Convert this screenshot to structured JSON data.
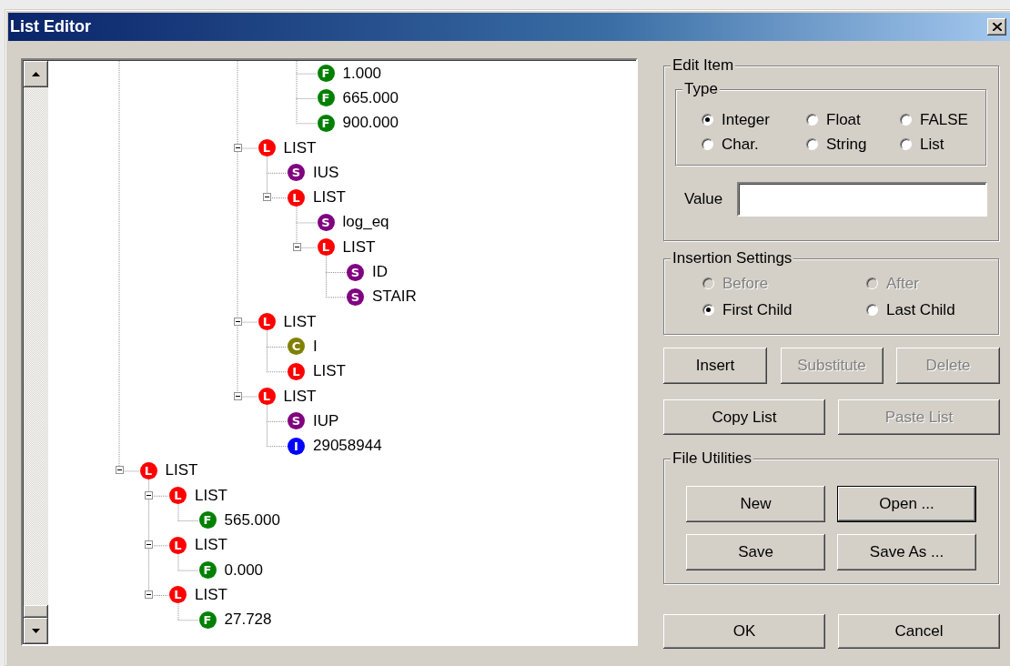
{
  "window": {
    "title": "List Editor"
  },
  "tree": {
    "items": [
      {
        "children": [
          {
            "children": [
              {
                "children": [
                  {
                    "children": [
                      {
                        "children": [
                          {
                            "children": [
                              {
                                "label": "1.000",
                                "badge": "F",
                                "kind": "float"
                              },
                              {
                                "label": "665.000",
                                "badge": "F",
                                "kind": "float"
                              },
                              {
                                "label": "900.000",
                                "badge": "F",
                                "kind": "float"
                              }
                            ]
                          }
                        ]
                      },
                      {
                        "label": "LIST",
                        "badge": "L",
                        "kind": "list",
                        "expanded": true,
                        "children": [
                          {
                            "label": "IUS",
                            "badge": "S",
                            "kind": "string"
                          },
                          {
                            "label": "LIST",
                            "badge": "L",
                            "kind": "list",
                            "expanded": true,
                            "children": [
                              {
                                "label": "log_eq",
                                "badge": "S",
                                "kind": "string"
                              },
                              {
                                "label": "LIST",
                                "badge": "L",
                                "kind": "list",
                                "expanded": true,
                                "children": [
                                  {
                                    "label": "ID",
                                    "badge": "S",
                                    "kind": "string"
                                  },
                                  {
                                    "label": "STAIR",
                                    "badge": "S",
                                    "kind": "string"
                                  }
                                ]
                              }
                            ]
                          }
                        ]
                      },
                      {
                        "label": "LIST",
                        "badge": "L",
                        "kind": "list",
                        "expanded": true,
                        "children": [
                          {
                            "label": "I",
                            "badge": "C",
                            "kind": "char"
                          },
                          {
                            "label": "LIST",
                            "badge": "L",
                            "kind": "list"
                          }
                        ]
                      },
                      {
                        "label": "LIST",
                        "badge": "L",
                        "kind": "list",
                        "expanded": true,
                        "children": [
                          {
                            "label": "IUP",
                            "badge": "S",
                            "kind": "string"
                          },
                          {
                            "label": "29058944",
                            "badge": "I",
                            "kind": "integer"
                          }
                        ]
                      }
                    ]
                  }
                ]
              }
            ]
          }
        ]
      },
      {
        "label": "LIST",
        "badge": "L",
        "kind": "list",
        "expanded": true,
        "children": [
          {
            "label": "LIST",
            "badge": "L",
            "kind": "list",
            "expanded": true,
            "children": [
              {
                "label": "565.000",
                "badge": "F",
                "kind": "float"
              }
            ]
          },
          {
            "label": "LIST",
            "badge": "L",
            "kind": "list",
            "expanded": true,
            "children": [
              {
                "label": "0.000",
                "badge": "F",
                "kind": "float"
              }
            ]
          },
          {
            "label": "LIST",
            "badge": "L",
            "kind": "list",
            "expanded": true,
            "children": [
              {
                "label": "27.728",
                "badge": "F",
                "kind": "float"
              }
            ]
          }
        ]
      }
    ]
  },
  "edit_item": {
    "title": "Edit Item",
    "type": {
      "title": "Type",
      "options": [
        {
          "label": "Integer",
          "selected": true
        },
        {
          "label": "Float",
          "selected": false
        },
        {
          "label": "FALSE",
          "selected": false
        },
        {
          "label": "Char.",
          "selected": false
        },
        {
          "label": "String",
          "selected": false
        },
        {
          "label": "List",
          "selected": false
        }
      ]
    },
    "value": {
      "label": "Value"
    }
  },
  "insertion_settings": {
    "title": "Insertion Settings",
    "options": [
      {
        "label": "Before",
        "selected": false,
        "disabled": true
      },
      {
        "label": "After",
        "selected": false,
        "disabled": true
      },
      {
        "label": "First Child",
        "selected": true,
        "disabled": false
      },
      {
        "label": "Last Child",
        "selected": false,
        "disabled": false
      }
    ]
  },
  "edit_buttons": [
    {
      "label": "Insert",
      "disabled": false
    },
    {
      "label": "Substitute",
      "disabled": true
    },
    {
      "label": "Delete",
      "disabled": true
    }
  ],
  "list_buttons": [
    {
      "label": "Copy List",
      "disabled": false
    },
    {
      "label": "Paste List",
      "disabled": true
    }
  ],
  "file_utilities": {
    "title": "File Utilities",
    "buttons": [
      {
        "label": "New",
        "default": false
      },
      {
        "label": "Open ...",
        "default": true
      },
      {
        "label": "Save",
        "default": false
      },
      {
        "label": "Save As ...",
        "default": false
      }
    ]
  },
  "dialog_buttons": [
    {
      "label": "OK"
    },
    {
      "label": "Cancel"
    }
  ]
}
